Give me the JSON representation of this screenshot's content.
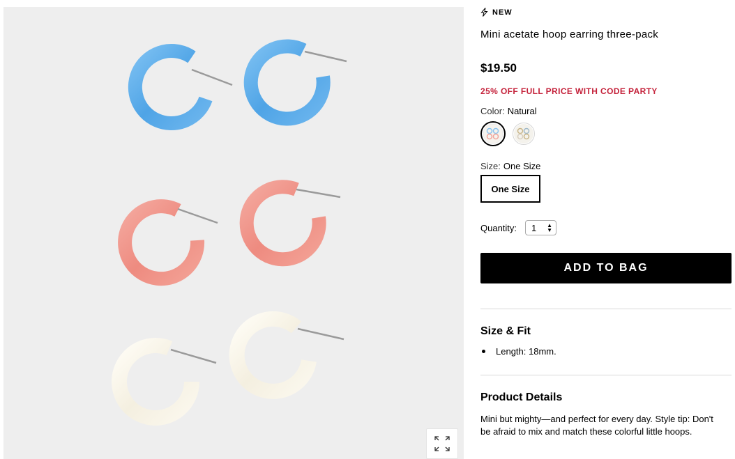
{
  "badge": {
    "label": "NEW",
    "icon": "lightning-bolt-icon"
  },
  "product": {
    "title": "Mini acetate hoop earring three-pack",
    "price": "$19.50",
    "promo": "25% OFF FULL PRICE WITH CODE PARTY"
  },
  "color": {
    "label": "Color:",
    "selected": "Natural",
    "swatch_count": 2
  },
  "size": {
    "label": "Size:",
    "selected": "One Size",
    "option": "One Size"
  },
  "quantity": {
    "label": "Quantity:",
    "value": "1"
  },
  "actions": {
    "add_to_bag": "ADD TO BAG"
  },
  "size_fit": {
    "title": "Size & Fit",
    "items": [
      "Length: 18mm."
    ]
  },
  "details": {
    "title": "Product Details",
    "text": "Mini but mighty—and perfect for every day. Style tip: Don't be afraid to mix and match these colorful little hoops."
  },
  "colors": {
    "promo": "#c4213a",
    "image_bg": "#eeeeee",
    "blue_hoop": "#5aaae8",
    "pink_hoop": "#f0968c",
    "white_hoop": "#f8f5ec"
  },
  "icons": {
    "zoom": "expand-icon"
  }
}
